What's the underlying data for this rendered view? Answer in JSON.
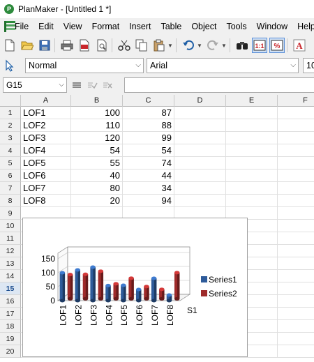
{
  "window": {
    "title": "PlanMaker - [Untitled 1 *]"
  },
  "menu": [
    "File",
    "Edit",
    "View",
    "Format",
    "Insert",
    "Table",
    "Object",
    "Tools",
    "Window",
    "Help"
  ],
  "toolbar": {
    "icons": [
      "new-icon",
      "open-icon",
      "save-icon",
      "print-icon",
      "pdf-icon",
      "print-preview-icon",
      "cut-icon",
      "copy-icon",
      "paste-icon",
      "undo-icon",
      "redo-icon",
      "find-icon",
      "zoom-100-icon",
      "percent-icon",
      "font-color-icon"
    ]
  },
  "format": {
    "style": "Normal",
    "font": "Arial",
    "size": "10"
  },
  "editbar": {
    "cell_ref": "G15",
    "formula": ""
  },
  "columns": [
    "A",
    "B",
    "C",
    "D",
    "E",
    "F"
  ],
  "rows": [
    "1",
    "2",
    "3",
    "4",
    "5",
    "6",
    "7",
    "8",
    "9",
    "10",
    "11",
    "12",
    "13",
    "14",
    "15",
    "16",
    "17",
    "18",
    "19",
    "20"
  ],
  "selected_row": "15",
  "cells": [
    {
      "a": "LOF1",
      "b": "100",
      "c": "87"
    },
    {
      "a": "LOF2",
      "b": "110",
      "c": "88"
    },
    {
      "a": "LOF3",
      "b": "120",
      "c": "99"
    },
    {
      "a": "LOF4",
      "b": "54",
      "c": "54"
    },
    {
      "a": "LOF5",
      "b": "55",
      "c": "74"
    },
    {
      "a": "LOF6",
      "b": "40",
      "c": "44"
    },
    {
      "a": "LOF7",
      "b": "80",
      "c": "34"
    },
    {
      "a": "LOF8",
      "b": "20",
      "c": "94"
    }
  ],
  "chart_data": {
    "type": "bar",
    "categories": [
      "LOF1",
      "LOF2",
      "LOF3",
      "LOF4",
      "LOF5",
      "LOF6",
      "LOF7",
      "LOF8"
    ],
    "series": [
      {
        "name": "Series1",
        "values": [
          100,
          110,
          120,
          54,
          55,
          40,
          80,
          20
        ],
        "color": "#2e5b9a"
      },
      {
        "name": "Series2",
        "values": [
          87,
          88,
          99,
          54,
          74,
          44,
          34,
          94
        ],
        "color": "#9e2a2a"
      }
    ],
    "yticks": [
      "0",
      "50",
      "100",
      "150"
    ],
    "ylim": [
      0,
      150
    ],
    "depth_label": "S1",
    "legend": "right",
    "style": "3d-columns"
  }
}
